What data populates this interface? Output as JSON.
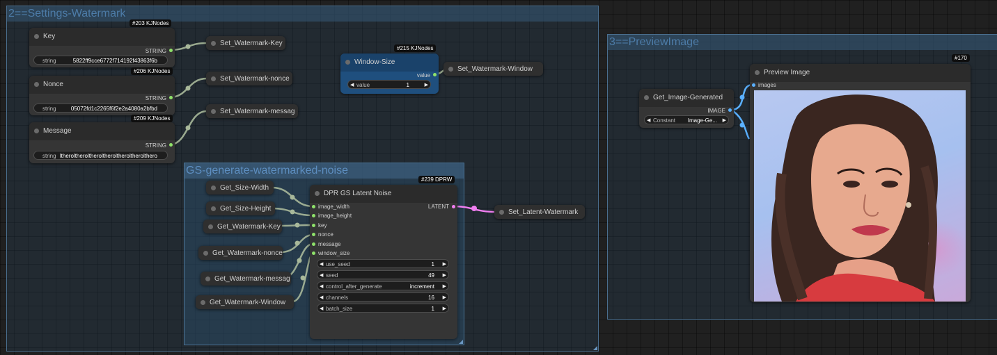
{
  "groups": {
    "settings": "2==Settings-Watermark",
    "preview": "3==PreviewImage",
    "noise": "GS-generate-watermarked-noise"
  },
  "nodes": {
    "key": {
      "title": "Key",
      "badge": "#203 KJNodes",
      "output": "STRING",
      "widget_label": "string",
      "widget_value": "5822ff9cce6772f714192f43863f6b"
    },
    "nonce": {
      "title": "Nonce",
      "badge": "#206 KJNodes",
      "output": "STRING",
      "widget_label": "string",
      "widget_value": "05072fd1c2265f6f2e2a4080a2bfbd"
    },
    "message": {
      "title": "Message",
      "badge": "#209 KJNodes",
      "output": "STRING",
      "widget_label": "string",
      "widget_value": "ltheroltheroltheroltheroltheroltherolthero"
    },
    "window_size": {
      "title": "Window-Size",
      "badge": "#215 KJNodes",
      "output": "value",
      "widget_label": "value",
      "widget_value": "1"
    },
    "set_key": "Set_Watermark-Key",
    "set_nonce": "Set_Watermark-nonce",
    "set_message": "Set_Watermark-messag",
    "set_window": "Set_Watermark-Window",
    "get_size_width": "Get_Size-Width",
    "get_size_height": "Get_Size-Height",
    "get_key": "Get_Watermark-Key",
    "get_nonce": "Get_Watermark-nonce",
    "get_message": "Get_Watermark-messag",
    "get_window": "Get_Watermark-Window",
    "set_latent": "Set_Latent-Watermark",
    "latent_noise": {
      "title": "DPR GS Latent Noise",
      "badge": "#239 DPRW",
      "inputs": [
        "image_width",
        "image_height",
        "key",
        "nonce",
        "message",
        "window_size"
      ],
      "output": "LATENT",
      "widgets": [
        {
          "label": "use_seed",
          "value": "1"
        },
        {
          "label": "seed",
          "value": "49"
        },
        {
          "label": "control_after_generate",
          "value": "increment"
        },
        {
          "label": "channels",
          "value": "16"
        },
        {
          "label": "batch_size",
          "value": "1"
        }
      ]
    },
    "get_image": {
      "title": "Get_Image-Generated",
      "output": "IMAGE",
      "widget_label": "Constant",
      "widget_value": "Image-Ge..."
    },
    "preview": {
      "title": "Preview Image",
      "badge": "#170",
      "input": "images"
    }
  },
  "colors": {
    "string_link": "#a8b89a",
    "latent_link": "#f07ef0",
    "image_link": "#5ab0ff"
  },
  "arrows": {
    "left": "◀",
    "right": "▶"
  }
}
